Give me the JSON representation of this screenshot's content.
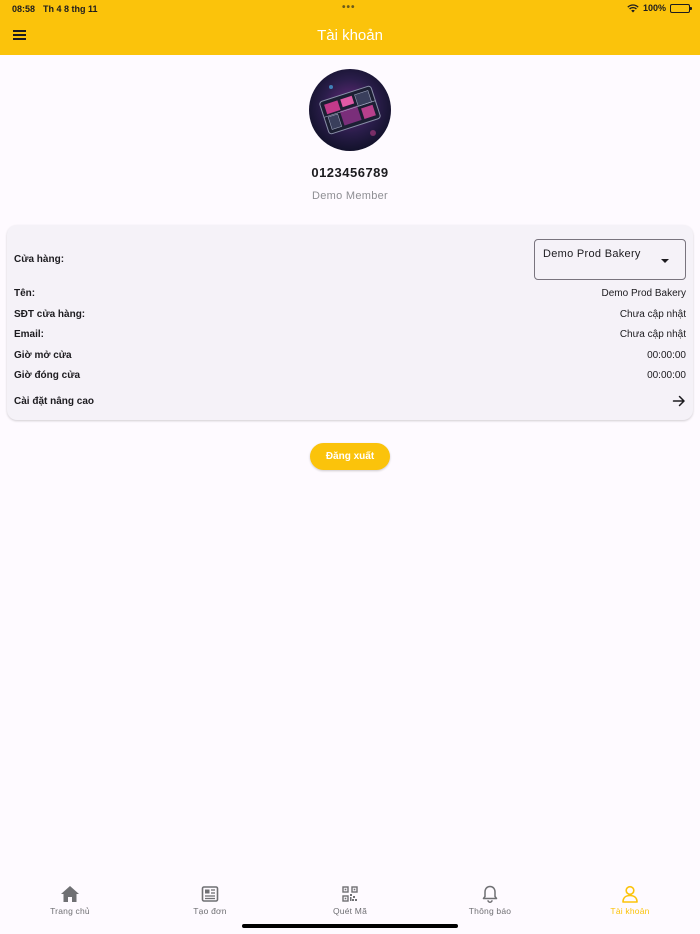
{
  "status_bar": {
    "time": "08:58",
    "date": "Th 4 8 thg 11",
    "battery": "100%"
  },
  "header": {
    "title": "Tài khoản"
  },
  "profile": {
    "phone": "0123456789",
    "member": "Demo Member"
  },
  "store_card": {
    "store_label": "Cửa hàng:",
    "store_selected": "Demo Prod Bakery",
    "rows": [
      {
        "label": "Tên:",
        "value": "Demo Prod Bakery"
      },
      {
        "label": "SĐT cửa hàng:",
        "value": "Chưa cập nhật"
      },
      {
        "label": "Email:",
        "value": "Chưa cập nhật"
      },
      {
        "label": "Giờ mở cửa",
        "value": "00:00:00"
      },
      {
        "label": "Giờ đóng cửa",
        "value": "00:00:00"
      }
    ],
    "advanced_label": "Cài đặt nâng cao"
  },
  "logout_label": "Đăng xuất",
  "nav": {
    "items": [
      {
        "label": "Trang chủ",
        "icon": "home-icon"
      },
      {
        "label": "Tạo đơn",
        "icon": "newspaper-icon"
      },
      {
        "label": "Quét Mã",
        "icon": "qr-code-icon"
      },
      {
        "label": "Thông báo",
        "icon": "bell-icon"
      },
      {
        "label": "Tài khoản",
        "icon": "person-icon"
      }
    ],
    "active_index": 4
  },
  "colors": {
    "primary": "#fbc30b",
    "background": "#fefaff",
    "card": "#f5f2f8",
    "muted": "#8e8e93"
  }
}
